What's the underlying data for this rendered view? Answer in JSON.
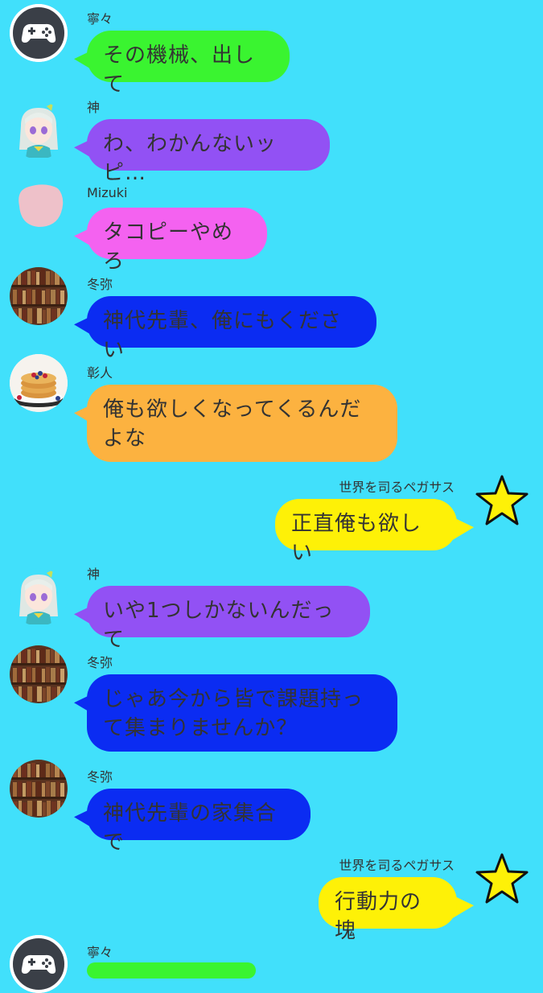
{
  "colors": {
    "background": "#41e0fb",
    "green": "#3af430",
    "purple": "#9251f4",
    "pink": "#f462f0",
    "blue": "#0b2cf2",
    "orange": "#fcb240",
    "yellow": "#fef107",
    "text": "#333333"
  },
  "messages": [
    {
      "sender": "寧々",
      "text": "その機械、出して",
      "side": "left",
      "avatar_icon": "gamepad-icon"
    },
    {
      "sender": "神",
      "text": "わ、わかんないッピ…",
      "side": "left",
      "avatar_icon": "anime-girl-avatar"
    },
    {
      "sender": "Mizuki",
      "text": "タコピーやめろ",
      "side": "left",
      "avatar_icon": "pink-blob-avatar"
    },
    {
      "sender": "冬弥",
      "text": "神代先輩、俺にもください",
      "side": "left",
      "avatar_icon": "bookshelf-avatar"
    },
    {
      "sender": "彰人",
      "text": "俺も欲しくなってくるんだよな",
      "side": "left",
      "avatar_icon": "pancake-avatar"
    },
    {
      "sender": "世界を司るペガサス",
      "text": "正直俺も欲しい",
      "side": "right",
      "avatar_icon": "star-icon"
    },
    {
      "sender": "神",
      "text": "いや1つしかないんだって",
      "side": "left",
      "avatar_icon": "anime-girl-avatar"
    },
    {
      "sender": "冬弥",
      "text": "じゃあ今から皆で課題持って集まりませんか？",
      "side": "left",
      "avatar_icon": "bookshelf-avatar"
    },
    {
      "sender": "冬弥",
      "text": "神代先輩の家集合で",
      "side": "left",
      "avatar_icon": "bookshelf-avatar"
    },
    {
      "sender": "世界を司るペガサス",
      "text": "行動力の塊",
      "side": "right",
      "avatar_icon": "star-icon"
    },
    {
      "sender": "寧々",
      "text": "",
      "side": "left",
      "avatar_icon": "gamepad-icon"
    }
  ]
}
